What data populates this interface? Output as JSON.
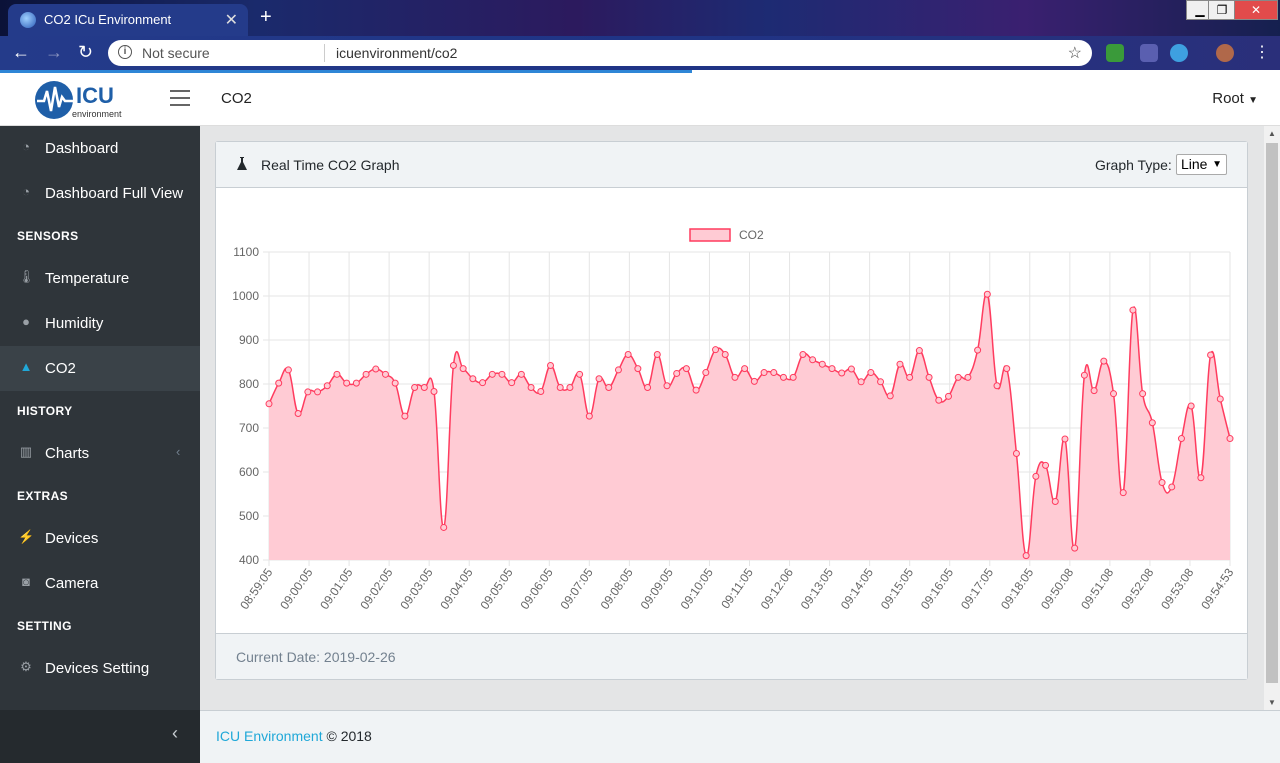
{
  "browser": {
    "tab_title": "CO2 ICu Environment",
    "security": "Not secure",
    "url": "icuenvironment/co2"
  },
  "header": {
    "page_title": "CO2",
    "user": "Root",
    "logo_text": "ICU",
    "logo_subtext": "environment"
  },
  "sidebar": {
    "items": [
      {
        "label": "Dashboard",
        "icon": "speedometer-icon"
      },
      {
        "label": "Dashboard Full View",
        "icon": "speedometer-icon"
      },
      {
        "section": "SENSORS"
      },
      {
        "label": "Temperature",
        "icon": "thermometer-icon"
      },
      {
        "label": "Humidity",
        "icon": "droplet-icon"
      },
      {
        "label": "CO2",
        "icon": "flask-icon",
        "active": true
      },
      {
        "section": "HISTORY"
      },
      {
        "label": "Charts",
        "icon": "bar-chart-icon"
      },
      {
        "section": "EXTRAS"
      },
      {
        "label": "Devices",
        "icon": "plug-icon"
      },
      {
        "label": "Camera",
        "icon": "camera-icon"
      },
      {
        "section": "SETTING"
      },
      {
        "label": "Devices Setting",
        "icon": "gear-icon"
      }
    ]
  },
  "card": {
    "title": "Real Time CO2 Graph",
    "graph_type_label": "Graph Type:",
    "graph_type_value": "Line",
    "current_date": "Current Date: 2019-02-26"
  },
  "footer": {
    "link": "ICU Environment",
    "text": "© 2018"
  },
  "colors": {
    "accent": "#20a8d8",
    "sidebar_bg": "#2f353a",
    "series_line": "#ff3c5f",
    "series_fill": "#ffcbd4"
  },
  "chart_data": {
    "type": "area",
    "legend": [
      "CO2"
    ],
    "legend_position": "top",
    "grid": true,
    "ylim": [
      400,
      1100
    ],
    "yticks": [
      400,
      500,
      600,
      700,
      800,
      900,
      1000,
      1100
    ],
    "x_tick_labels": [
      "08:59:05",
      "09:00:05",
      "09:01:05",
      "09:02:05",
      "09:03:05",
      "09:04:05",
      "09:05:05",
      "09:06:05",
      "09:07:05",
      "09:08:05",
      "09:09:05",
      "09:10:05",
      "09:11:05",
      "09:12:06",
      "09:13:05",
      "09:14:05",
      "09:15:05",
      "09:16:05",
      "09:17:05",
      "09:18:05",
      "09:50:08",
      "09:51:08",
      "09:52:08",
      "09:53:08",
      "09:54:53"
    ],
    "series": [
      {
        "name": "CO2",
        "values": [
          755,
          802,
          832,
          733,
          782,
          782,
          796,
          822,
          802,
          802,
          822,
          834,
          822,
          802,
          727,
          792,
          792,
          783,
          474,
          842,
          835,
          812,
          803,
          822,
          822,
          803,
          822,
          792,
          783,
          842,
          792,
          792,
          822,
          727,
          812,
          792,
          832,
          867,
          835,
          792,
          867,
          796,
          824,
          835,
          786,
          826,
          878,
          867,
          815,
          835,
          806,
          826,
          826,
          815,
          815,
          867,
          855,
          845,
          835,
          825,
          834,
          805,
          826,
          805,
          773,
          845,
          815,
          876,
          815,
          763,
          772,
          815,
          815,
          877,
          1004,
          796,
          835,
          642,
          410,
          590,
          615,
          533,
          675,
          427,
          820,
          785,
          852,
          778,
          553,
          968,
          778,
          712,
          576,
          566,
          676,
          750,
          587,
          866,
          766,
          676
        ]
      }
    ]
  }
}
